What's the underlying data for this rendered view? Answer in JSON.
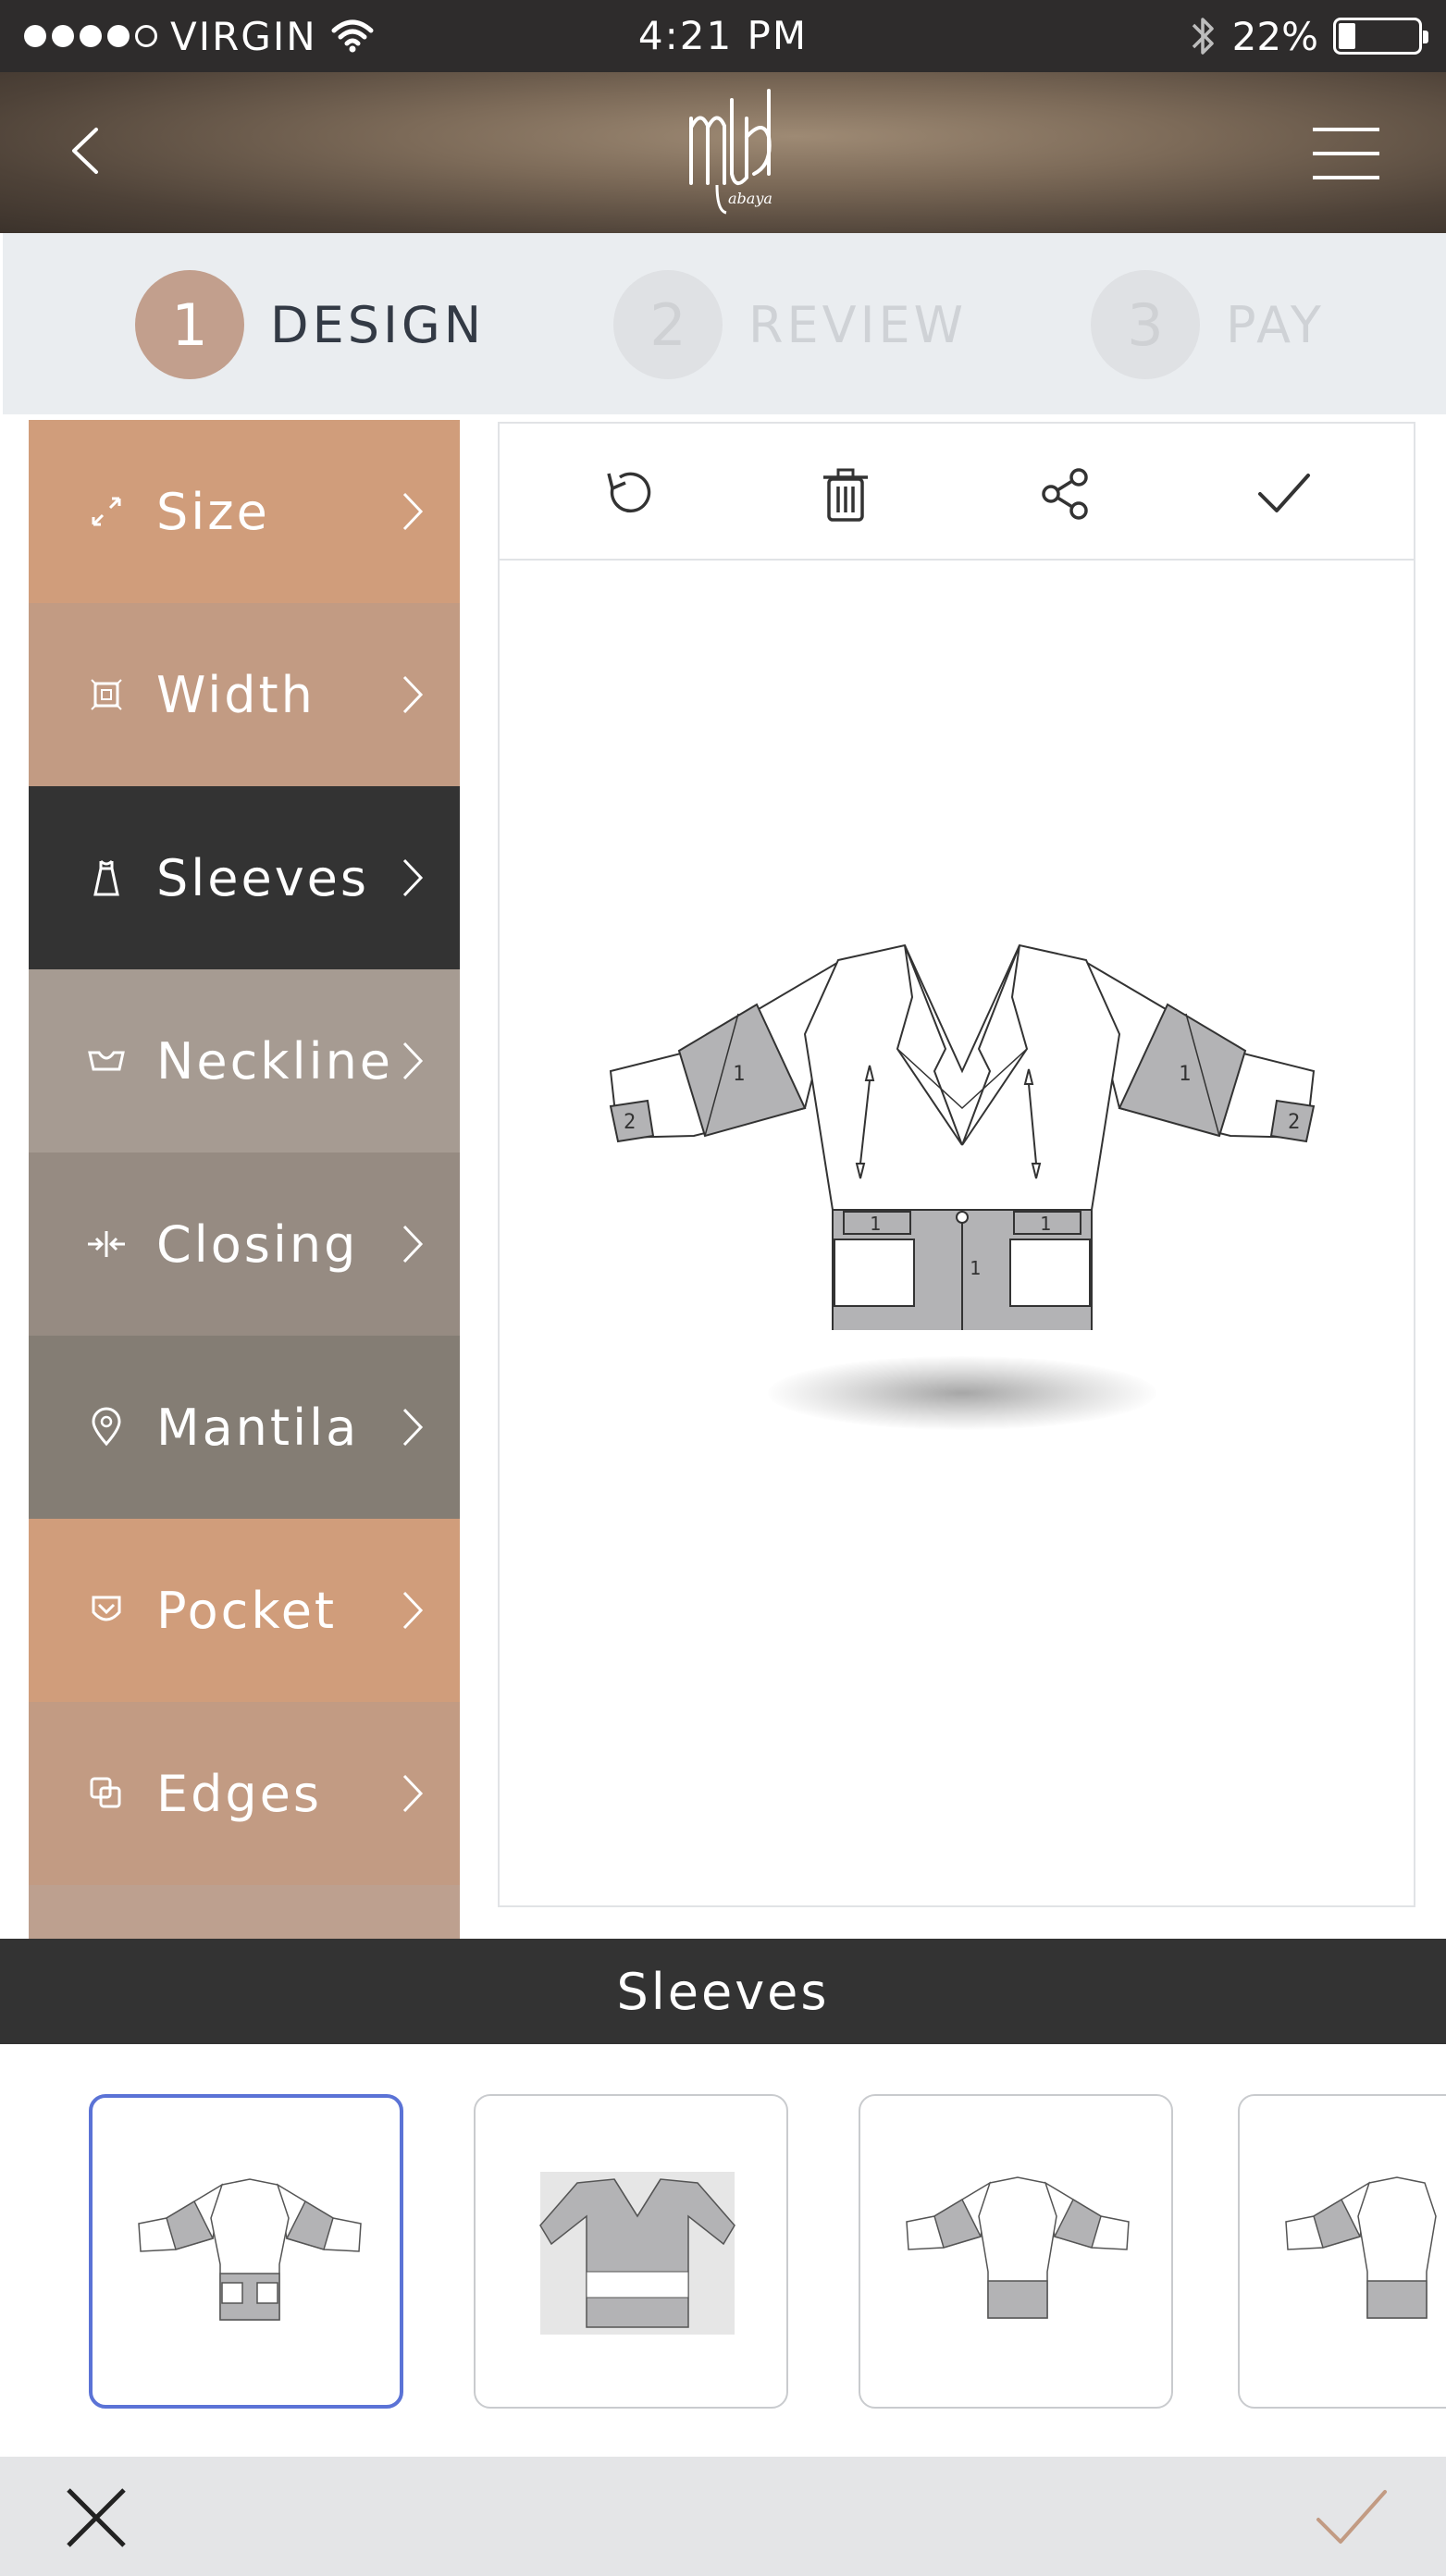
{
  "status_bar": {
    "carrier": "VIRGIN",
    "time": "4:21 PM",
    "battery": "22%",
    "signal_dots_filled": 4,
    "signal_dots_total": 5
  },
  "header": {
    "logo_text": "abaya",
    "back_icon": "chevron-left-icon",
    "menu_icon": "hamburger-icon"
  },
  "steps": [
    {
      "number": "1",
      "label": "DESIGN",
      "active": true
    },
    {
      "number": "2",
      "label": "REVIEW",
      "active": false
    },
    {
      "number": "3",
      "label": "PAY",
      "active": false
    }
  ],
  "sidebar": {
    "items": [
      {
        "label": "Size",
        "icon": "resize-arrows-icon",
        "color": "#d09d7b"
      },
      {
        "label": "Width",
        "icon": "width-box-icon",
        "color": "#c29b83"
      },
      {
        "label": "Sleeves",
        "icon": "dress-icon",
        "color": "#333333"
      },
      {
        "label": "Neckline",
        "icon": "neckline-icon",
        "color": "#a69b92"
      },
      {
        "label": "Closing",
        "icon": "closing-arrows-icon",
        "color": "#968b82"
      },
      {
        "label": "Mantila",
        "icon": "location-pin-icon",
        "color": "#847d74"
      },
      {
        "label": "Pocket",
        "icon": "pocket-icon",
        "color": "#d09d7b"
      },
      {
        "label": "Edges",
        "icon": "layers-icon",
        "color": "#c29b83"
      }
    ]
  },
  "toolbar": {
    "tools": [
      "undo-icon",
      "trash-icon",
      "share-icon",
      "check-icon"
    ]
  },
  "garment_labels": {
    "sleeve_left_main": "1",
    "sleeve_left_cuff": "2",
    "sleeve_right_main": "1",
    "sleeve_right_cuff": "2",
    "pocket_flap_left": "1",
    "pocket_flap_right": "1",
    "center_panel": "1"
  },
  "section_title": "Sleeves",
  "options": [
    {
      "name": "sleeve-option-1",
      "selected": true
    },
    {
      "name": "sleeve-option-2",
      "selected": false
    },
    {
      "name": "sleeve-option-3",
      "selected": false
    },
    {
      "name": "sleeve-option-4",
      "selected": false
    }
  ],
  "bottom_bar": {
    "cancel_icon": "close-icon",
    "confirm_icon": "check-icon"
  },
  "colors": {
    "accent": "#d09d7b",
    "selected_border": "#5b73d6",
    "dark": "#333333"
  }
}
